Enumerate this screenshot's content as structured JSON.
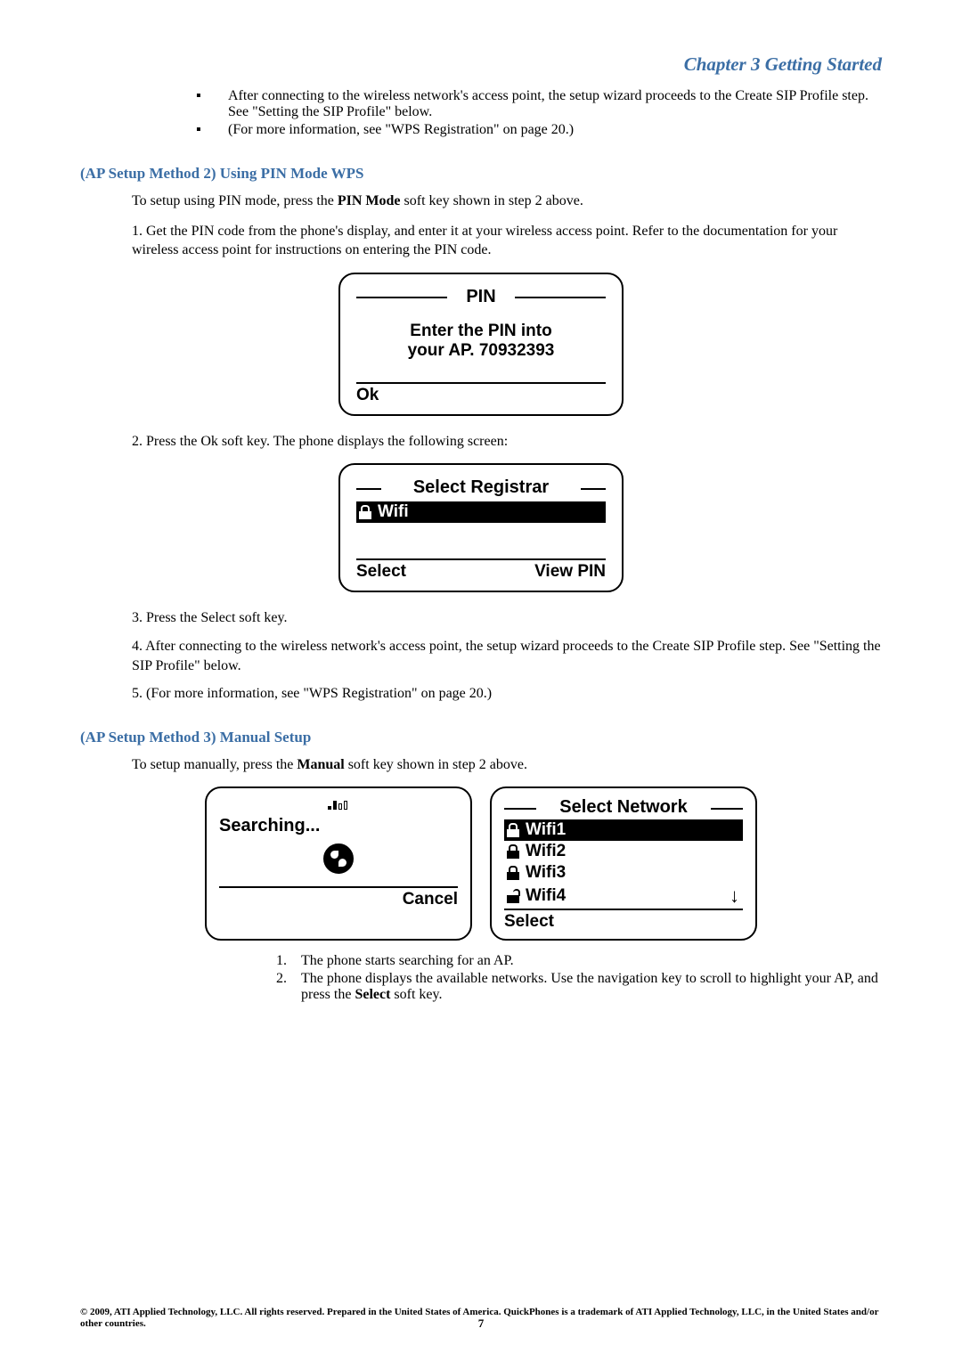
{
  "chapter": "Chapter 3 Getting Started",
  "top_bullets": [
    "After connecting to the wireless network's access point, the setup wizard proceeds to the Create SIP Profile step. See \"Setting the SIP Profile\" below.",
    "(For more information, see \"WPS Registration\" on page 20.)"
  ],
  "method2": {
    "heading": "(AP Setup Method 2) Using PIN Mode WPS",
    "intro_a": "To setup using PIN mode, press the ",
    "intro_bold": "PIN Mode",
    "intro_b": " soft key shown in step 2 above.",
    "step1": "1. Get the PIN code from the phone's display, and enter it at your wireless access point. Refer to the documentation for your wireless access point for instructions on entering the PIN code.",
    "screen_pin": {
      "title": "PIN",
      "line1": "Enter the PIN into",
      "line2": "your AP. 70932393",
      "softkey": "Ok"
    },
    "step2": "2.  Press the Ok soft key. The phone displays the following screen:",
    "screen_reg": {
      "title": "Select Registrar",
      "item": "Wifi",
      "left": "Select",
      "right": "View PIN"
    },
    "step3": "3. Press the Select soft key.",
    "step4": "4. After connecting to the wireless network's access point, the setup wizard proceeds to the Create SIP Profile step. See \"Setting the SIP Profile\" below.",
    "step5": "5. (For more information, see \"WPS Registration\" on page 20.)"
  },
  "method3": {
    "heading": "(AP Setup Method 3) Manual Setup",
    "intro_a": "To setup manually, press the ",
    "intro_bold": "Manual",
    "intro_b": " soft key shown in step 2 above.",
    "screen_search": {
      "text": "Searching...",
      "softkey": "Cancel"
    },
    "screen_net": {
      "title": "Select Network",
      "items": [
        "Wifi1",
        "Wifi2",
        "Wifi3",
        "Wifi4"
      ],
      "softkey": "Select"
    },
    "substeps": [
      "The phone starts searching for an AP.",
      "The phone displays the available networks. Use the navigation key to scroll to highlight your AP, and press the Select soft key."
    ],
    "sub2_a": "The phone displays the available networks. Use the navigation key to scroll to highlight your AP, and press the ",
    "sub2_bold": "Select",
    "sub2_b": " soft key."
  },
  "footer": "© 2009, ATI Applied Technology, LLC. All rights reserved. Prepared in the United States of America. QuickPhones is a trademark of ATI Applied Technology, LLC, in the United States and/or other countries.",
  "page": "7"
}
